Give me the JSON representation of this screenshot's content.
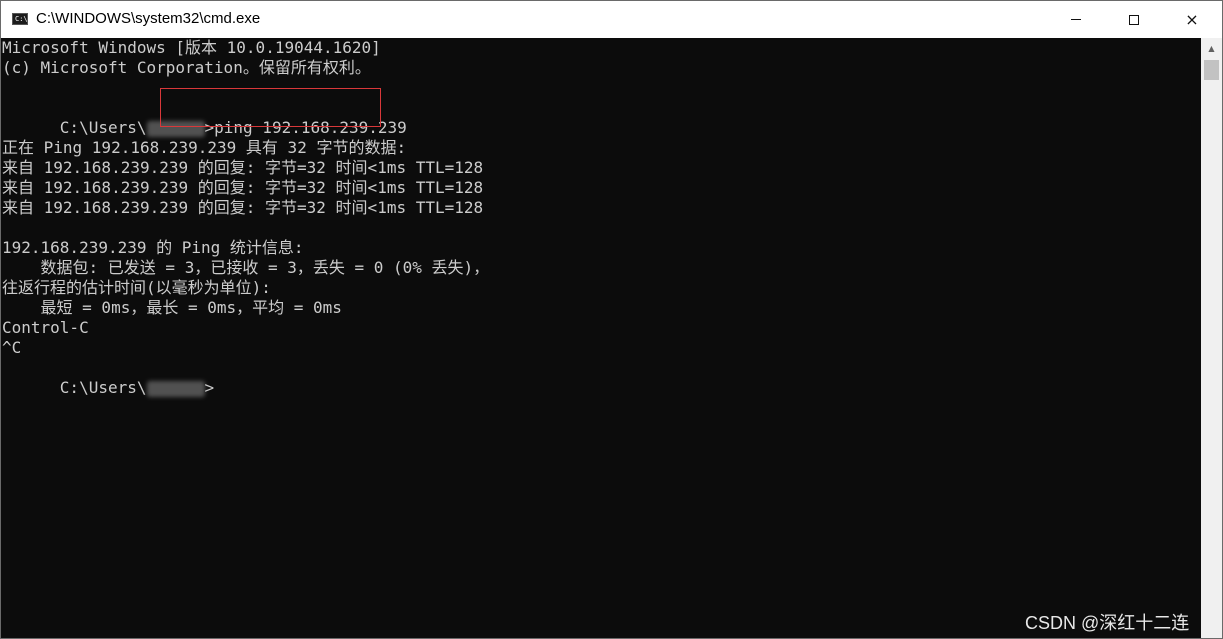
{
  "window": {
    "title": "C:\\WINDOWS\\system32\\cmd.exe",
    "icon": "cmd-icon",
    "icon_text": "C:\\",
    "controls": {
      "minimize": "minimize-icon",
      "maximize": "maximize-icon",
      "close": "×"
    }
  },
  "console": {
    "lines": [
      "Microsoft Windows [版本 10.0.19044.1620]",
      "(c) Microsoft Corporation。保留所有权利。",
      "",
      "",
      "",
      "正在 Ping 192.168.239.239 具有 32 字节的数据:",
      "来自 192.168.239.239 的回复: 字节=32 时间<1ms TTL=128",
      "来自 192.168.239.239 的回复: 字节=32 时间<1ms TTL=128",
      "来自 192.168.239.239 的回复: 字节=32 时间<1ms TTL=128",
      "",
      "192.168.239.239 的 Ping 统计信息:",
      "    数据包: 已发送 = 3，已接收 = 3，丢失 = 0 (0% 丢失)，",
      "往返行程的估计时间(以毫秒为单位):",
      "    最短 = 0ms，最长 = 0ms，平均 = 0ms",
      "Control-C",
      "^C",
      ""
    ],
    "prompt_prefix": "C:\\Users\\",
    "prompt_suffix": ">",
    "command": "ping 192.168.239.239",
    "final_prompt_prefix": "C:\\Users\\",
    "final_prompt_suffix": ">"
  },
  "colors": {
    "console_bg": "#0c0c0c",
    "console_text": "#cccccc",
    "highlight_border": "#d9383a"
  },
  "watermark": "CSDN @深红十二连"
}
